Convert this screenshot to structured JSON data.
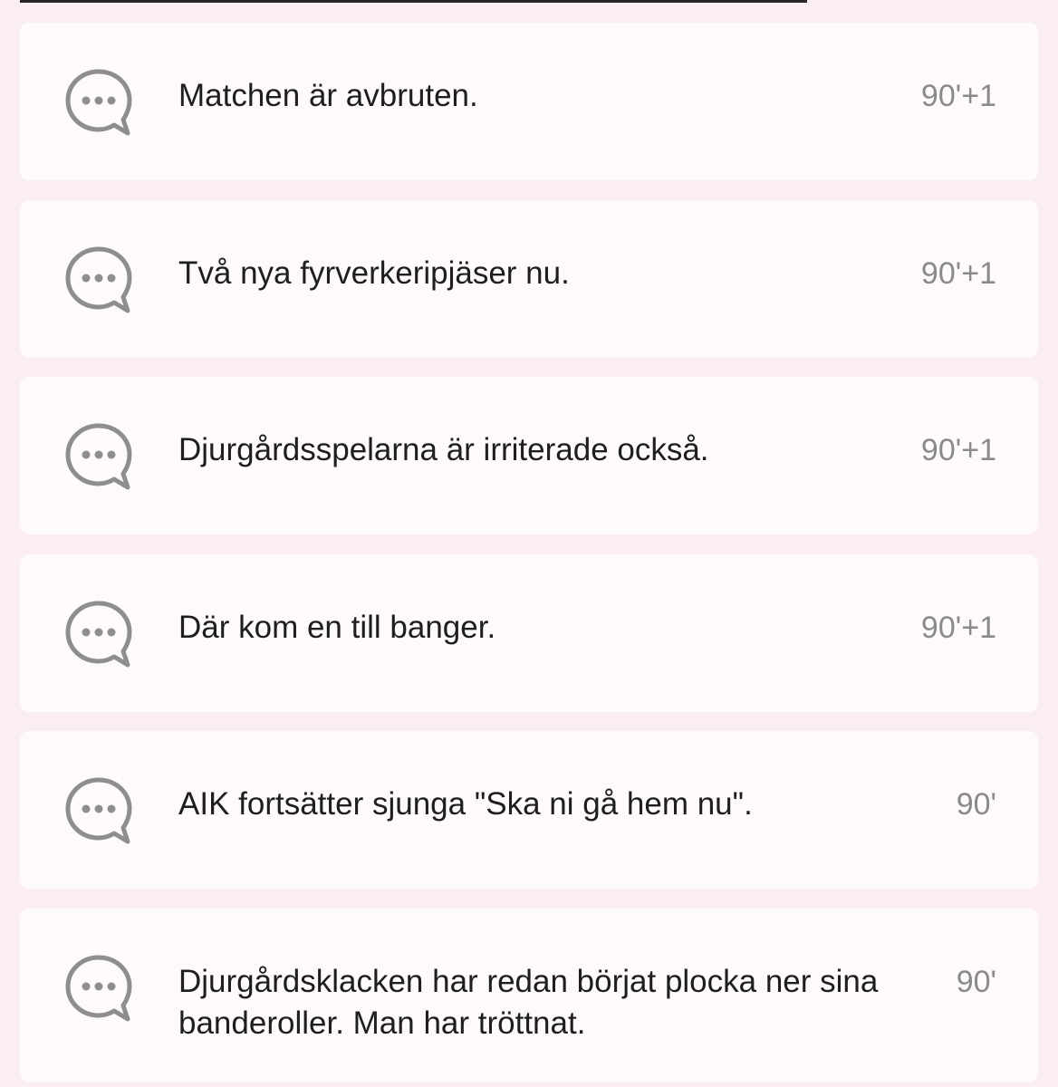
{
  "feed": {
    "items": [
      {
        "text": "Matchen är avbruten.",
        "minute": "90'+1",
        "icon": "chat-bubble-icon"
      },
      {
        "text": "Två nya fyrverkeripjäser nu.",
        "minute": "90'+1",
        "icon": "chat-bubble-icon"
      },
      {
        "text": "Djurgårdsspelarna är irriterade också.",
        "minute": "90'+1",
        "icon": "chat-bubble-icon"
      },
      {
        "text": "Där kom en till banger.",
        "minute": "90'+1",
        "icon": "chat-bubble-icon"
      },
      {
        "text": "AIK fortsätter sjunga \"Ska ni gå hem nu\".",
        "minute": "90'",
        "icon": "chat-bubble-icon"
      },
      {
        "text": "Djurgårdsklacken har redan börjat plocka ner sina banderoller. Man har tröttnat.",
        "minute": "90'",
        "icon": "chat-bubble-icon"
      }
    ]
  },
  "colors": {
    "page_background": "#fbeef1",
    "card_background": "#fefafb",
    "icon": "#8e8e8e",
    "minute_text": "#8a8a8a",
    "body_text": "#1e1e1e"
  }
}
